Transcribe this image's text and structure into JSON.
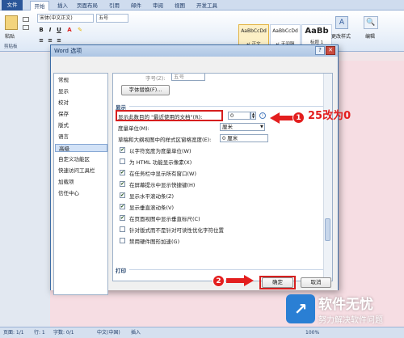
{
  "ribbon": {
    "tabs": [
      "文件",
      "开始",
      "插入",
      "页面布局",
      "引用",
      "邮件",
      "审阅",
      "视图",
      "开发工具"
    ],
    "font_name": "宋体(中文正文)",
    "font_size": "五号",
    "paste_label": "粘贴",
    "clipboard_label": "剪贴板",
    "styles": [
      {
        "sample": "AaBbCcDd",
        "name": "↵ 正文"
      },
      {
        "sample": "AaBbCcDd",
        "name": "↵ 无间隔"
      },
      {
        "sample": "AaBb",
        "name": "标题 1"
      }
    ],
    "change_styles": "更改样式",
    "edit_label": "编辑"
  },
  "dialog": {
    "title": "Word 选项",
    "help_btn": "?",
    "close_btn": "✕",
    "nav": [
      "常规",
      "显示",
      "校对",
      "保存",
      "版式",
      "语言",
      "高级",
      "自定义功能区",
      "快速访问工具栏",
      "加载项",
      "信任中心"
    ],
    "selected_nav": "高级",
    "content": {
      "font_size_label": "字号(Z):",
      "font_size_value": "五号",
      "font_substitution_btn": "字体替换(F)...",
      "display_section": "显示",
      "recent_docs_label": "显示此数目的 \"最近使用的文档\"(R):",
      "recent_docs_value": "0",
      "measure_label": "度量单位(M):",
      "measure_value": "厘米",
      "style_area_label": "草稿和大纲视图中的样式区窗格宽度(E):",
      "style_area_value": "0 厘米",
      "checkboxes": [
        {
          "label": "以字符宽度为度量单位(W)",
          "checked": true
        },
        {
          "label": "为 HTML 功能显示像素(X)",
          "checked": false
        },
        {
          "label": "在任务栏中显示所有窗口(W)",
          "checked": true
        },
        {
          "label": "在屏幕提示中显示快捷键(H)",
          "checked": true
        },
        {
          "label": "显示水平滚动条(Z)",
          "checked": true
        },
        {
          "label": "显示垂直滚动条(V)",
          "checked": true
        },
        {
          "label": "在页面视图中显示垂直标尺(C)",
          "checked": true
        },
        {
          "label": "针对版式而不是针对可读性优化字符位置",
          "checked": false
        },
        {
          "label": "禁用硬件图形加速(G)",
          "checked": false
        }
      ],
      "print_section": "打印"
    },
    "ok_btn": "确定",
    "cancel_btn": "取消"
  },
  "annotations": {
    "step1": "1",
    "step2": "2",
    "note": "25改为0"
  },
  "statusbar": {
    "page": "页面: 1/1",
    "line": "行: 1",
    "words": "字数: 0/1",
    "lang": "中文(中国)",
    "mode": "插入",
    "zoom": "100%"
  },
  "watermark": {
    "title": "软件无忧",
    "subtitle": "努力解决软件问题"
  }
}
